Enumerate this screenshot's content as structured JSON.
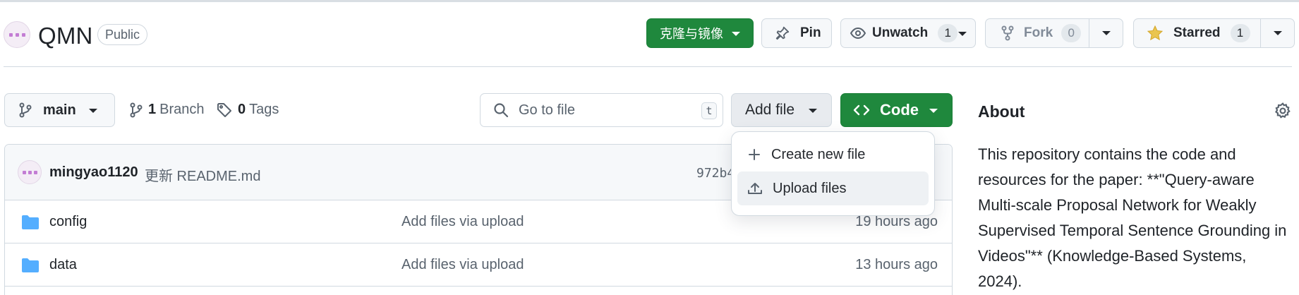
{
  "repo": {
    "name": "QMN",
    "visibility": "Public"
  },
  "header_actions": {
    "clone_label": "克隆与镜像",
    "pin_label": "Pin",
    "unwatch_label": "Unwatch",
    "unwatch_count": "1",
    "fork_label": "Fork",
    "fork_count": "0",
    "starred_label": "Starred",
    "starred_count": "1"
  },
  "toolbar": {
    "branch_name": "main",
    "branches_count": "1",
    "branches_label": "Branch",
    "tags_count": "0",
    "tags_label": "Tags",
    "goto_placeholder": "Go to file",
    "goto_shortcut": "t",
    "add_file_label": "Add file",
    "code_label": "Code"
  },
  "add_file_menu": {
    "items": [
      {
        "label": "Create new file",
        "icon": "plus-icon"
      },
      {
        "label": "Upload files",
        "icon": "upload-icon"
      }
    ]
  },
  "latest_commit": {
    "author": "mingyao1120",
    "message": "更新 README.md",
    "sha": "972b4"
  },
  "files": [
    {
      "name": "config",
      "message": "Add files via upload",
      "time": "19 hours ago",
      "icon": "folder-icon"
    },
    {
      "name": "data",
      "message": "Add files via upload",
      "time": "13 hours ago",
      "icon": "folder-icon"
    }
  ],
  "about": {
    "title": "About",
    "description": "This repository contains the code and resources for the paper: **\"Query-aware Multi-scale Proposal Network for Weakly Supervised Temporal Sentence Grounding in Videos\"** (Knowledge-Based Systems, 2024)."
  },
  "colors": {
    "green": "#1f883d",
    "folder": "#54aeff",
    "star": "#eac54f",
    "muted_text": "#59636e",
    "border": "#d1d9e0"
  }
}
